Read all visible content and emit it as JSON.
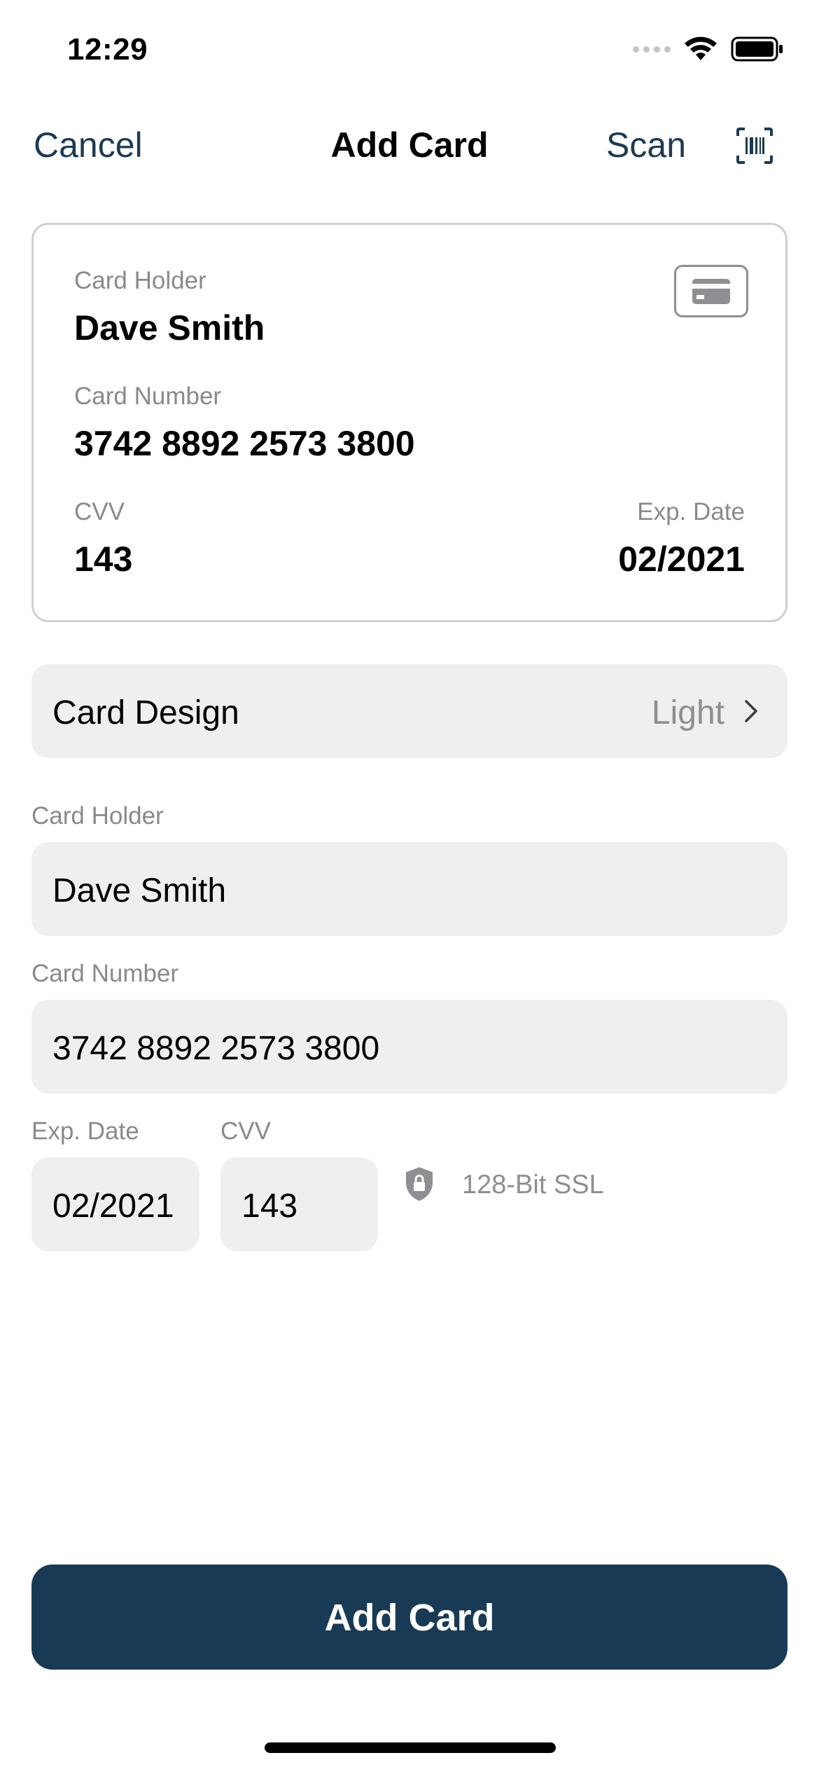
{
  "status_bar": {
    "time": "12:29"
  },
  "nav": {
    "cancel_label": "Cancel",
    "title": "Add Card",
    "scan_label": "Scan",
    "scan_icon": "barcode-scan-icon"
  },
  "card_preview": {
    "holder_label": "Card Holder",
    "holder_value": "Dave Smith",
    "number_label": "Card Number",
    "number_value": "3742 8892 2573 3800",
    "cvv_label": "CVV",
    "cvv_value": "143",
    "exp_label": "Exp. Date",
    "exp_value": "02/2021",
    "card_icon": "credit-card-icon"
  },
  "design": {
    "label": "Card Design",
    "value": "Light"
  },
  "form": {
    "holder_label": "Card Holder",
    "holder_value": "Dave Smith",
    "number_label": "Card Number",
    "number_value": "3742 8892 2573 3800",
    "exp_label": "Exp. Date",
    "exp_value": "02/2021",
    "cvv_label": "CVV",
    "cvv_value": "143",
    "ssl_text": "128-Bit SSL",
    "ssl_icon": "shield-lock-icon"
  },
  "actions": {
    "add_label": "Add Card"
  },
  "colors": {
    "accent": "#193a55",
    "link": "#1d3a52",
    "field_bg": "#efefef",
    "secondary_text": "#8e8e93"
  }
}
